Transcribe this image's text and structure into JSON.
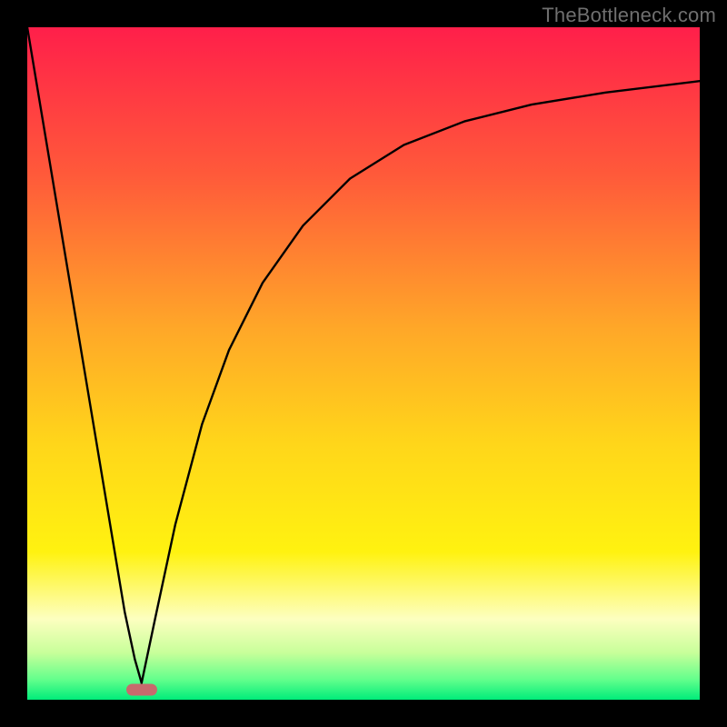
{
  "watermark": "TheBottleneck.com",
  "colors": {
    "frame_bg": "#000000",
    "marker_fill": "#c76a6d",
    "curve_stroke": "#000000",
    "watermark_text": "#6f6f6f",
    "gradient_stops": [
      {
        "offset": 0.0,
        "color": "#ff1f4a"
      },
      {
        "offset": 0.22,
        "color": "#ff5a3a"
      },
      {
        "offset": 0.45,
        "color": "#ffa828"
      },
      {
        "offset": 0.62,
        "color": "#ffd61a"
      },
      {
        "offset": 0.78,
        "color": "#fff210"
      },
      {
        "offset": 0.88,
        "color": "#fdffc0"
      },
      {
        "offset": 0.93,
        "color": "#c8ff9a"
      },
      {
        "offset": 0.97,
        "color": "#63ff8c"
      },
      {
        "offset": 1.0,
        "color": "#00ec7a"
      }
    ]
  },
  "chart_data": {
    "type": "line",
    "title": "",
    "xlabel": "",
    "ylabel": "",
    "xlim": [
      0,
      100
    ],
    "ylim": [
      0,
      100
    ],
    "grid": false,
    "legend": false,
    "notes": "Heat-gradient background (red=high at top → green=low at bottom). One curve with two branches: a steep near-linear descent from top-left to a minimum, then a saturating rise to upper-right. Values are read off pixel positions (0–100 normalized).",
    "series": [
      {
        "name": "left-descent",
        "x": [
          0.0,
          3.0,
          6.0,
          9.0,
          12.0,
          14.5,
          16.0,
          17.0
        ],
        "y": [
          100.0,
          82.0,
          64.0,
          46.0,
          28.0,
          13.0,
          6.0,
          2.5
        ]
      },
      {
        "name": "right-rise",
        "x": [
          17.0,
          19.0,
          22.0,
          26.0,
          30.0,
          35.0,
          41.0,
          48.0,
          56.0,
          65.0,
          75.0,
          86.0,
          100.0
        ],
        "y": [
          2.5,
          12.0,
          26.0,
          41.0,
          52.0,
          62.0,
          70.5,
          77.5,
          82.5,
          86.0,
          88.5,
          90.3,
          92.0
        ]
      }
    ],
    "marker": {
      "x": 17.0,
      "y": 1.5
    }
  }
}
